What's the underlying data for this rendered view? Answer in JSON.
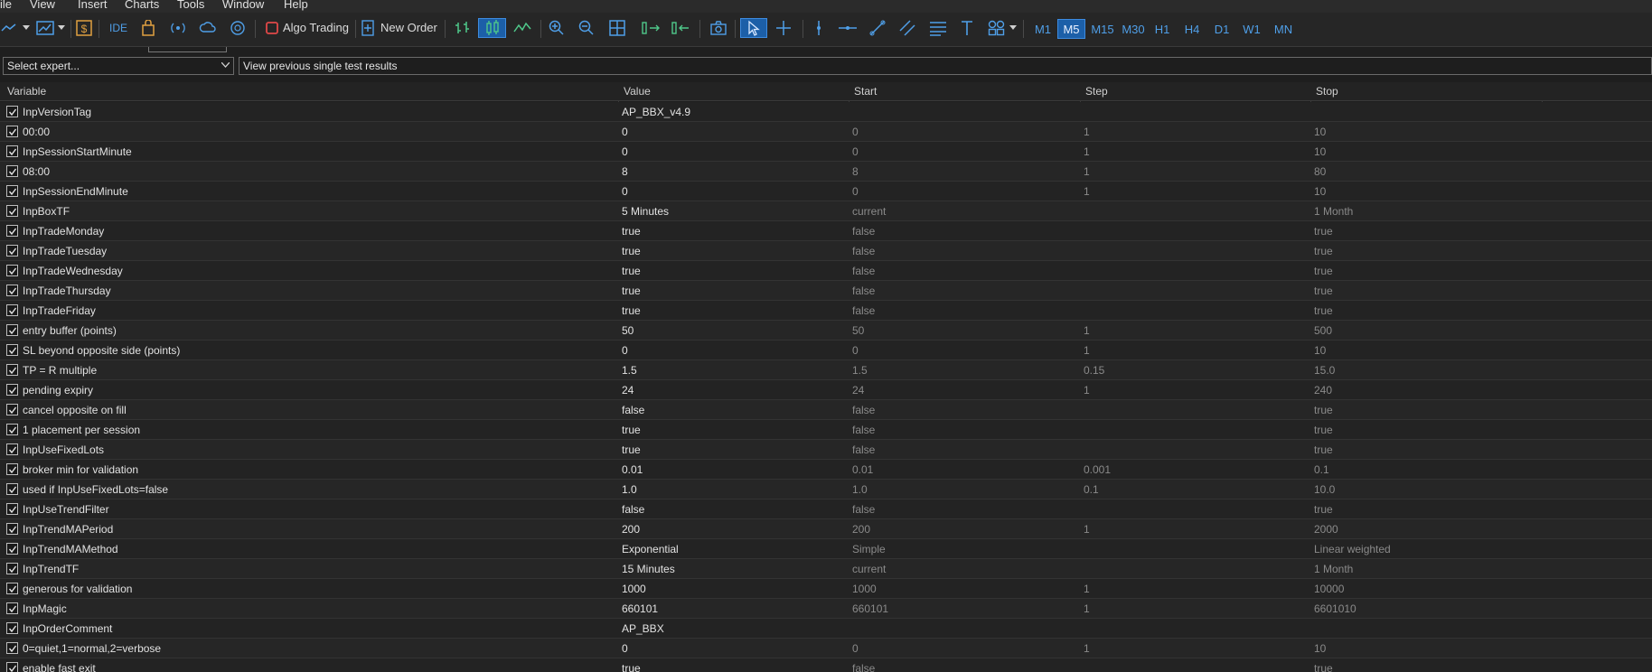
{
  "menu": [
    "ile",
    "View",
    "Insert",
    "Charts",
    "Tools",
    "Window",
    "Help"
  ],
  "toolbar": {
    "algo_trading_label": "Algo Trading",
    "new_order_label": "New Order",
    "ide_label": "IDE",
    "timeframes": [
      "M1",
      "M5",
      "M15",
      "M30",
      "H1",
      "H4",
      "D1",
      "W1",
      "MN"
    ],
    "active_timeframe": "M5"
  },
  "expert": {
    "select_value": "Select expert...",
    "view_previous_label": "View previous single test results"
  },
  "columns": [
    "Variable",
    "Value",
    "Start",
    "Step",
    "Stop"
  ],
  "rows": [
    {
      "variable": "InpVersionTag",
      "value": "AP_BBX_v4.9",
      "start": "",
      "step": "",
      "stop": "",
      "checked": true
    },
    {
      "variable": "00:00",
      "value": "0",
      "start": "0",
      "step": "1",
      "stop": "10",
      "checked": true
    },
    {
      "variable": "InpSessionStartMinute",
      "value": "0",
      "start": "0",
      "step": "1",
      "stop": "10",
      "checked": true
    },
    {
      "variable": "08:00",
      "value": "8",
      "start": "8",
      "step": "1",
      "stop": "80",
      "checked": true
    },
    {
      "variable": "InpSessionEndMinute",
      "value": "0",
      "start": "0",
      "step": "1",
      "stop": "10",
      "checked": true
    },
    {
      "variable": "InpBoxTF",
      "value": "5 Minutes",
      "start": "current",
      "step": "",
      "stop": "1 Month",
      "checked": true
    },
    {
      "variable": "InpTradeMonday",
      "value": "true",
      "start": "false",
      "step": "",
      "stop": "true",
      "checked": true
    },
    {
      "variable": "InpTradeTuesday",
      "value": "true",
      "start": "false",
      "step": "",
      "stop": "true",
      "checked": true
    },
    {
      "variable": "InpTradeWednesday",
      "value": "true",
      "start": "false",
      "step": "",
      "stop": "true",
      "checked": true
    },
    {
      "variable": "InpTradeThursday",
      "value": "true",
      "start": "false",
      "step": "",
      "stop": "true",
      "checked": true
    },
    {
      "variable": "InpTradeFriday",
      "value": "true",
      "start": "false",
      "step": "",
      "stop": "true",
      "checked": true
    },
    {
      "variable": "entry buffer (points)",
      "value": "50",
      "start": "50",
      "step": "1",
      "stop": "500",
      "checked": true
    },
    {
      "variable": "SL beyond opposite side (points)",
      "value": "0",
      "start": "0",
      "step": "1",
      "stop": "10",
      "checked": true
    },
    {
      "variable": "TP = R multiple",
      "value": "1.5",
      "start": "1.5",
      "step": "0.15",
      "stop": "15.0",
      "checked": true
    },
    {
      "variable": "pending expiry",
      "value": "24",
      "start": "24",
      "step": "1",
      "stop": "240",
      "checked": true
    },
    {
      "variable": "cancel opposite on fill",
      "value": "false",
      "start": "false",
      "step": "",
      "stop": "true",
      "checked": true
    },
    {
      "variable": "1 placement per session",
      "value": "true",
      "start": "false",
      "step": "",
      "stop": "true",
      "checked": true
    },
    {
      "variable": "InpUseFixedLots",
      "value": "true",
      "start": "false",
      "step": "",
      "stop": "true",
      "checked": true
    },
    {
      "variable": "broker min for validation",
      "value": "0.01",
      "start": "0.01",
      "step": "0.001",
      "stop": "0.1",
      "checked": true
    },
    {
      "variable": "used if InpUseFixedLots=false",
      "value": "1.0",
      "start": "1.0",
      "step": "0.1",
      "stop": "10.0",
      "checked": true
    },
    {
      "variable": "InpUseTrendFilter",
      "value": "false",
      "start": "false",
      "step": "",
      "stop": "true",
      "checked": true
    },
    {
      "variable": "InpTrendMAPeriod",
      "value": "200",
      "start": "200",
      "step": "1",
      "stop": "2000",
      "checked": true
    },
    {
      "variable": "InpTrendMAMethod",
      "value": "Exponential",
      "start": "Simple",
      "step": "",
      "stop": "Linear weighted",
      "checked": true
    },
    {
      "variable": "InpTrendTF",
      "value": "15 Minutes",
      "start": "current",
      "step": "",
      "stop": "1 Month",
      "checked": true
    },
    {
      "variable": "generous for validation",
      "value": "1000",
      "start": "1000",
      "step": "1",
      "stop": "10000",
      "checked": true
    },
    {
      "variable": "InpMagic",
      "value": "660101",
      "start": "660101",
      "step": "1",
      "stop": "6601010",
      "checked": true
    },
    {
      "variable": "InpOrderComment",
      "value": "AP_BBX",
      "start": "",
      "step": "",
      "stop": "",
      "checked": true
    },
    {
      "variable": "0=quiet,1=normal,2=verbose",
      "value": "0",
      "start": "0",
      "step": "1",
      "stop": "10",
      "checked": true
    },
    {
      "variable": "enable fast exit",
      "value": "true",
      "start": "false",
      "step": "",
      "stop": "true",
      "checked": true
    }
  ]
}
